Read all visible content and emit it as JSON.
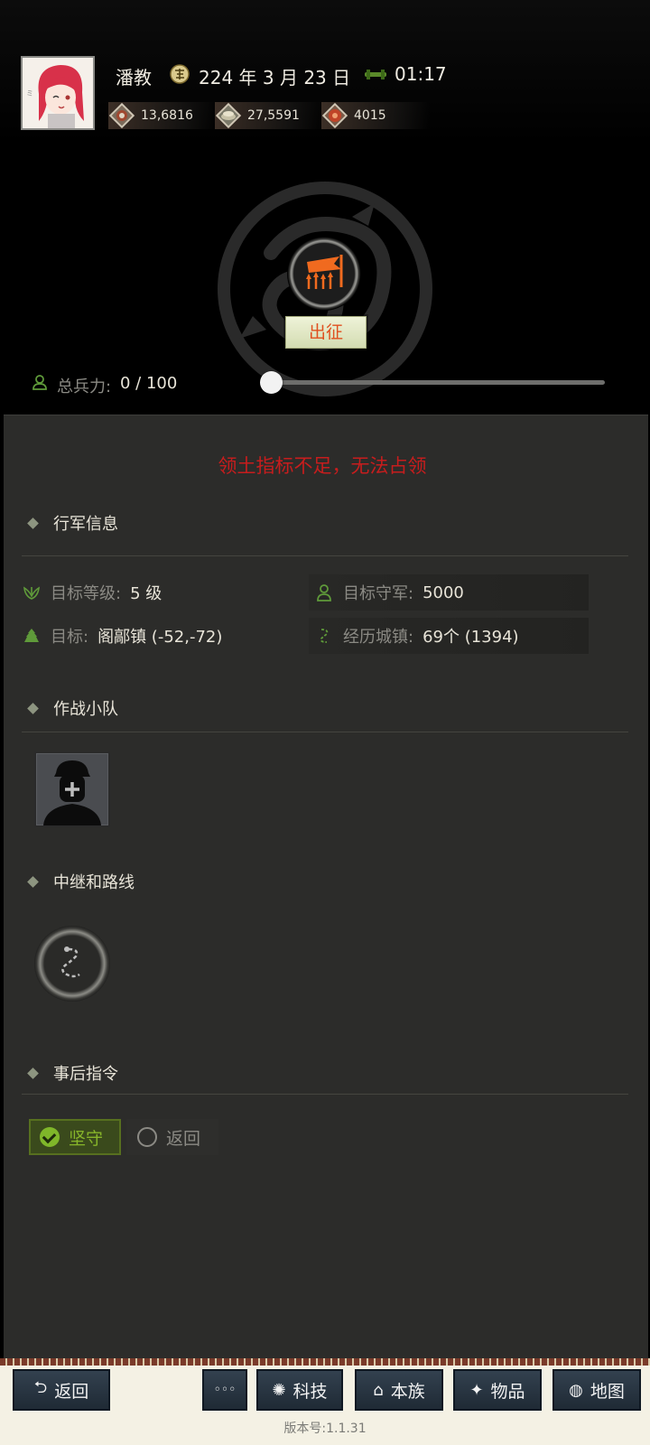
{
  "player": {
    "name": "潘教",
    "date": "224 年 3 月 23 日",
    "time": "01:17"
  },
  "resources": [
    {
      "icon": "silver-icon",
      "value": "13,6816",
      "color": "#a04830"
    },
    {
      "icon": "grain-icon",
      "value": "27,5591",
      "color": "#8a8a7a"
    },
    {
      "icon": "gold-icon",
      "value": "4015",
      "color": "#c04428"
    }
  ],
  "march": {
    "label": "出征"
  },
  "troops": {
    "label": "总兵力:",
    "value": "0 / 100",
    "fraction": 0.0
  },
  "warning": "领土指标不足，无法占领",
  "sections": {
    "march_info": "行军信息",
    "squad": "作战小队",
    "relay": "中继和路线",
    "after": "事后指令"
  },
  "info": {
    "level_label": "目标等级:",
    "level_value": "5 级",
    "garrison_label": "目标守军:",
    "garrison_value": "5000",
    "target_label": "目标:",
    "target_value": "阁鄗镇 (-52,-72)",
    "towns_label": "经历城镇:",
    "towns_value": "69个 (1394)"
  },
  "after_options": {
    "hold": "坚守",
    "return": "返回",
    "selected": "坚守"
  },
  "nav": {
    "back": "返回",
    "more": "◦◦◦",
    "tech": "科技",
    "clan": "本族",
    "items": "物品",
    "map": "地图"
  },
  "version": "版本号:1.1.31",
  "colors": {
    "accent_green": "#7fb62a",
    "warning_red": "#c71d1d",
    "march_orange": "#e0501f",
    "panel": "#2c2c2a"
  }
}
